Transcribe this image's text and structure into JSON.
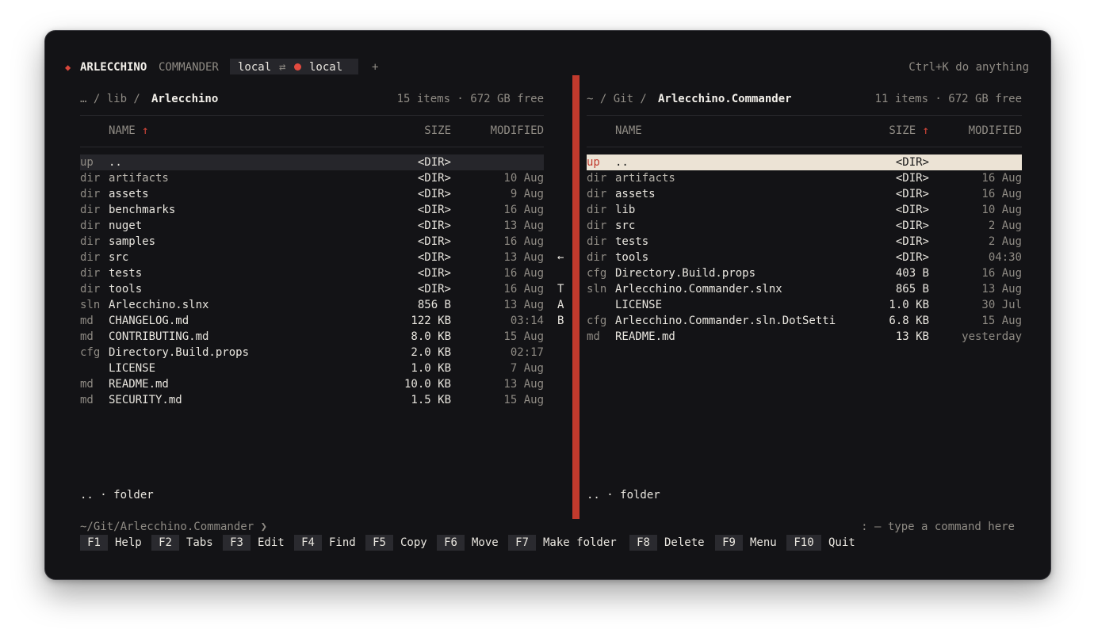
{
  "app": {
    "name_bold": "ARLECCHINO",
    "name_rest": "COMMANDER",
    "tab_left": "local",
    "tab_swap": "⇄",
    "tab_right": "local",
    "add_tab": "+",
    "shortcut_hint": "Ctrl+K do anything"
  },
  "left_panel": {
    "path_prefix": "… / lib / ",
    "path_current": "Arlecchino",
    "summary": "15 items · 672 GB free",
    "col_name": "NAME",
    "col_sort_arrow": "↑",
    "col_size": "SIZE",
    "col_modified": "MODIFIED",
    "status": ".. · folder",
    "rows": [
      {
        "tag": "up",
        "name": "..",
        "size": "<DIR>",
        "modified": ""
      },
      {
        "tag": "dir",
        "name": "artifacts",
        "size": "<DIR>",
        "modified": "10 Aug"
      },
      {
        "tag": "dir",
        "name": "assets",
        "size": "<DIR>",
        "modified": "9 Aug"
      },
      {
        "tag": "dir",
        "name": "benchmarks",
        "size": "<DIR>",
        "modified": "16 Aug"
      },
      {
        "tag": "dir",
        "name": "nuget",
        "size": "<DIR>",
        "modified": "13 Aug"
      },
      {
        "tag": "dir",
        "name": "samples",
        "size": "<DIR>",
        "modified": "16 Aug"
      },
      {
        "tag": "dir",
        "name": "src",
        "size": "<DIR>",
        "modified": "13 Aug"
      },
      {
        "tag": "dir",
        "name": "tests",
        "size": "<DIR>",
        "modified": "16 Aug"
      },
      {
        "tag": "dir",
        "name": "tools",
        "size": "<DIR>",
        "modified": "16 Aug"
      },
      {
        "tag": "sln",
        "name": "Arlecchino.slnx",
        "size": "856 B",
        "modified": "13 Aug"
      },
      {
        "tag": "md",
        "name": "CHANGELOG.md",
        "size": "122 KB",
        "modified": "03:14"
      },
      {
        "tag": "md",
        "name": "CONTRIBUTING.md",
        "size": "8.0 KB",
        "modified": "15 Aug"
      },
      {
        "tag": "cfg",
        "name": "Directory.Build.props",
        "size": "2.0 KB",
        "modified": "02:17"
      },
      {
        "tag": "",
        "name": "LICENSE",
        "size": "1.0 KB",
        "modified": "7 Aug"
      },
      {
        "tag": "md",
        "name": "README.md",
        "size": "10.0 KB",
        "modified": "13 Aug"
      },
      {
        "tag": "md",
        "name": "SECURITY.md",
        "size": "1.5 KB",
        "modified": "15 Aug"
      }
    ]
  },
  "right_panel": {
    "path_prefix": "~ / Git / ",
    "path_current": "Arlecchino.Commander",
    "summary": "11 items · 672 GB free",
    "col_name": "NAME",
    "col_size": "SIZE",
    "col_sort_arrow": "↑",
    "col_modified": "MODIFIED",
    "status": ".. · folder",
    "rows": [
      {
        "tag": "up",
        "name": "..",
        "size": "<DIR>",
        "modified": ""
      },
      {
        "tag": "dir",
        "name": "artifacts",
        "size": "<DIR>",
        "modified": "16 Aug"
      },
      {
        "tag": "dir",
        "name": "assets",
        "size": "<DIR>",
        "modified": "16 Aug"
      },
      {
        "tag": "dir",
        "name": "lib",
        "size": "<DIR>",
        "modified": "10 Aug"
      },
      {
        "tag": "dir",
        "name": "src",
        "size": "<DIR>",
        "modified": "2 Aug"
      },
      {
        "tag": "dir",
        "name": "tests",
        "size": "<DIR>",
        "modified": "2 Aug"
      },
      {
        "tag": "dir",
        "name": "tools",
        "size": "<DIR>",
        "modified": "04:30"
      },
      {
        "tag": "cfg",
        "name": "Directory.Build.props",
        "size": "403 B",
        "modified": "16 Aug"
      },
      {
        "tag": "sln",
        "name": "Arlecchino.Commander.slnx",
        "size": "865 B",
        "modified": "13 Aug"
      },
      {
        "tag": "",
        "name": "LICENSE",
        "size": "1.0 KB",
        "modified": "30 Jul"
      },
      {
        "tag": "cfg",
        "name": "Arlecchino.Commander.sln.DotSetti",
        "size": "6.8 KB",
        "modified": "15 Aug"
      },
      {
        "tag": "md",
        "name": "README.md",
        "size": "13 KB",
        "modified": "yesterday"
      }
    ]
  },
  "gutter": {
    "arrow": "←",
    "letters": [
      "T",
      "A",
      "B"
    ]
  },
  "command_line": {
    "cwd": "~/Git/Arlecchino.Commander ❯",
    "hint": ": — type a command here"
  },
  "function_keys": [
    {
      "key": "F1",
      "label": "Help"
    },
    {
      "key": "F2",
      "label": "Tabs"
    },
    {
      "key": "F3",
      "label": "Edit"
    },
    {
      "key": "F4",
      "label": "Find"
    },
    {
      "key": "F5",
      "label": "Copy"
    },
    {
      "key": "F6",
      "label": "Move"
    },
    {
      "key": "F7",
      "label": "Make folder"
    },
    {
      "key": "F8",
      "label": "Delete"
    },
    {
      "key": "F9",
      "label": "Menu"
    },
    {
      "key": "F10",
      "label": "Quit"
    }
  ],
  "colors": {
    "accent": "#c13a2d",
    "selection_active": "#ece3d5",
    "selection_inactive": "#26262b"
  }
}
